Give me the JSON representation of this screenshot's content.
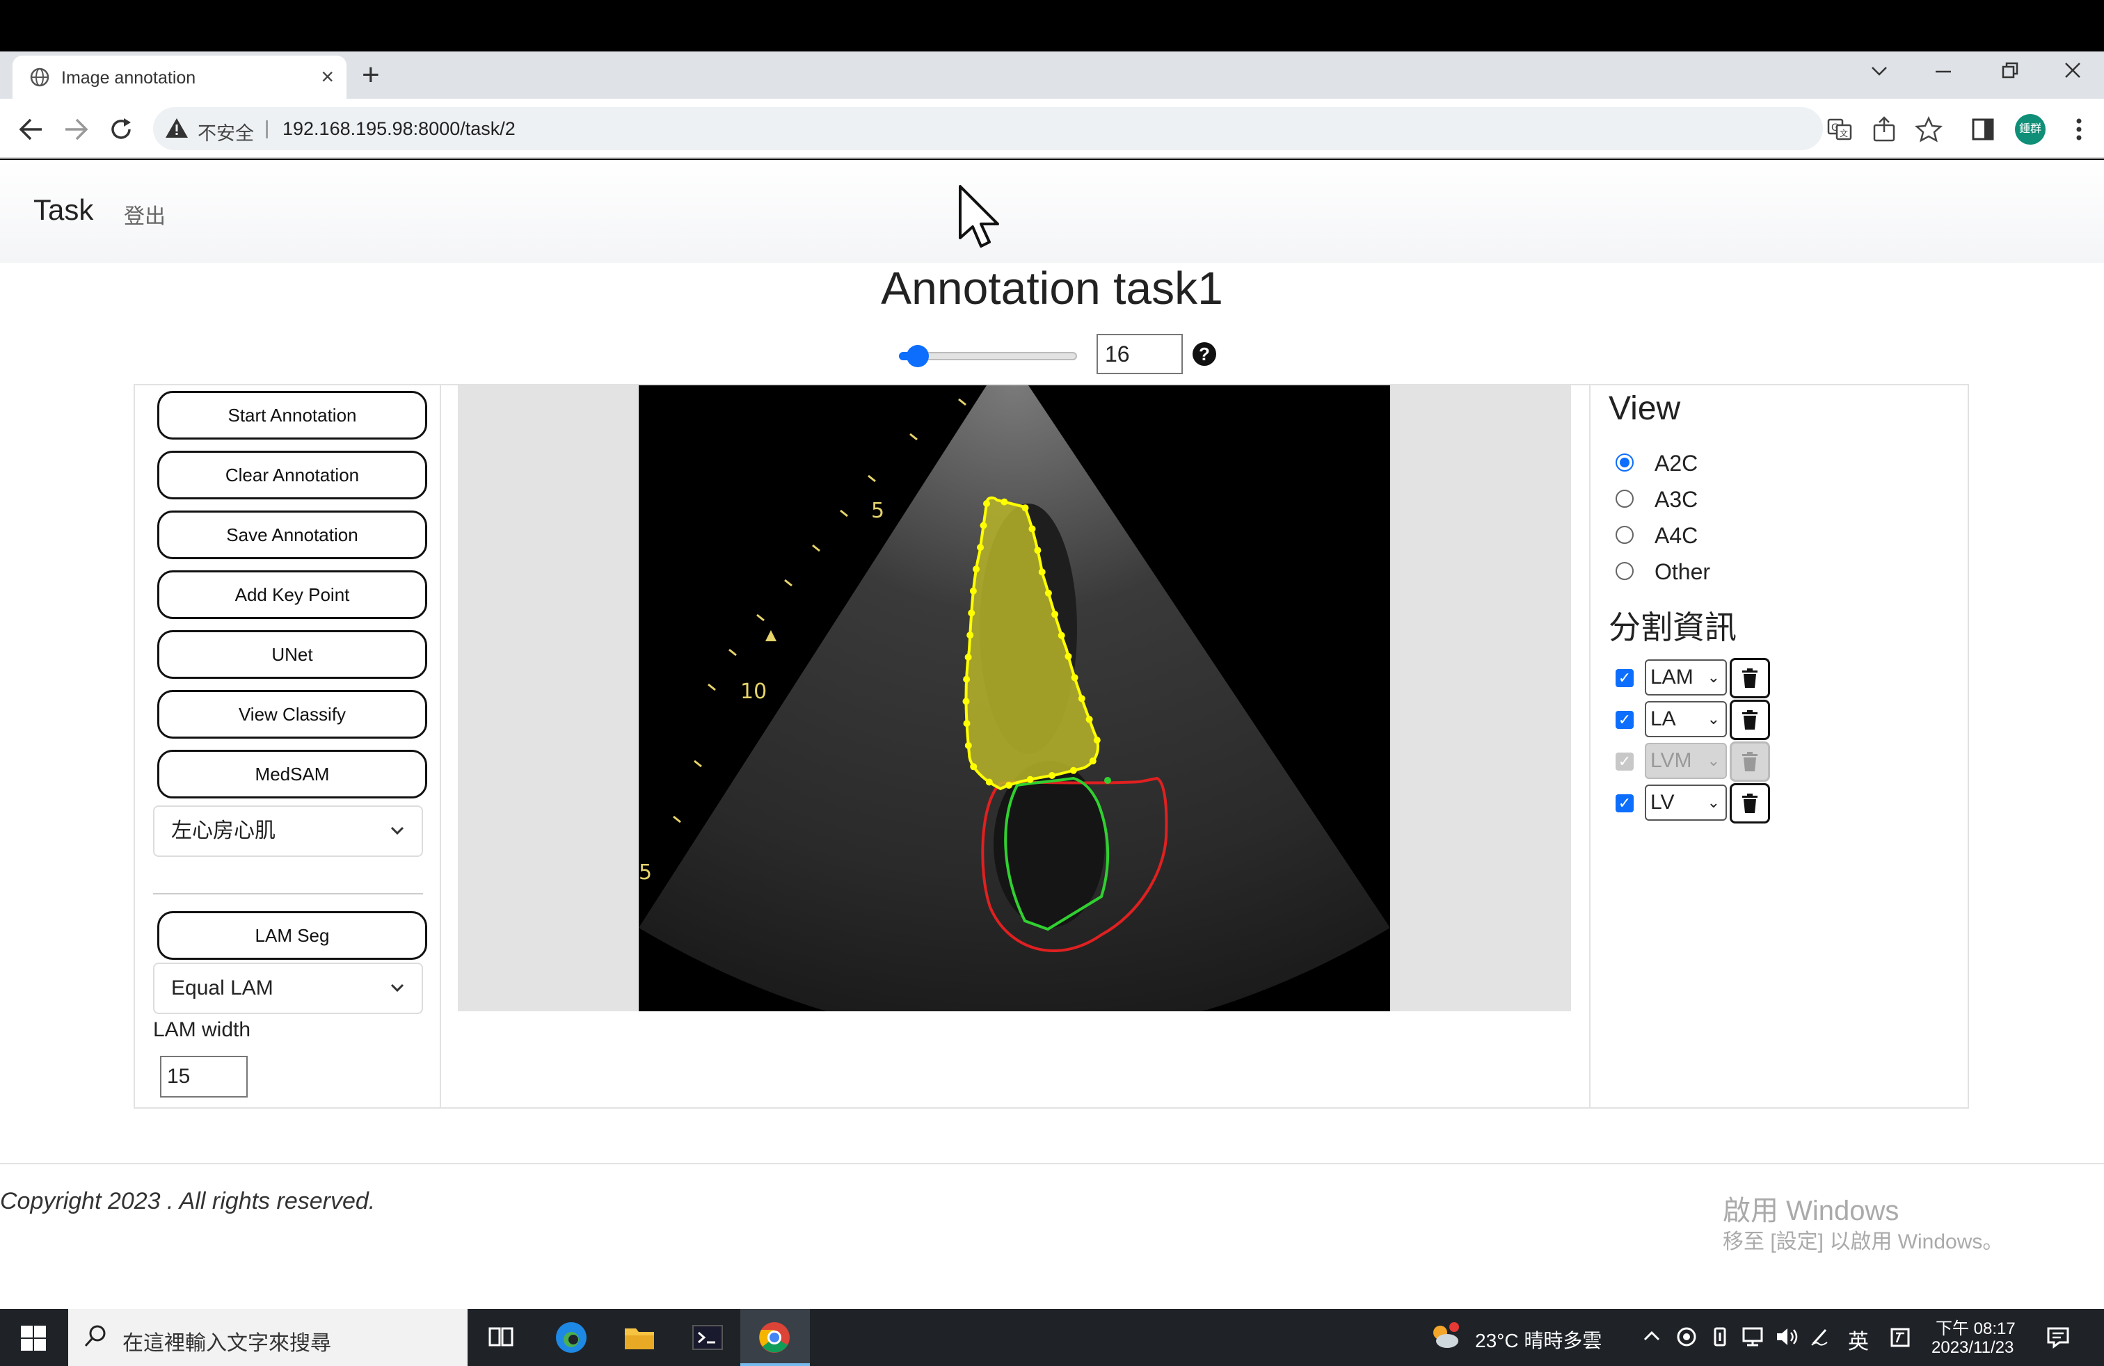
{
  "browser": {
    "tab_title": "Image annotation",
    "tab_close": "×",
    "new_tab": "+",
    "url_insecure": "不安全",
    "url_separator": "|",
    "url": "192.168.195.98:8000/task/2",
    "avatar_text": "鍾群"
  },
  "nav": {
    "brand": "Task",
    "logout": "登出"
  },
  "page": {
    "title": "Annotation task1",
    "frame_value": "16",
    "frame_fraction": 0.05,
    "help": "?"
  },
  "left_panel": {
    "buttons": [
      "Start Annotation",
      "Clear Annotation",
      "Save Annotation",
      "Add Key Point",
      "UNet",
      "View Classify",
      "MedSAM"
    ],
    "structure_select": "左心房心肌",
    "lam_seg_button": "LAM Seg",
    "lam_mode_select": "Equal LAM",
    "lam_width_label": "LAM width",
    "lam_width_value": "15"
  },
  "echo_image": {
    "depth_labels": [
      "5",
      "10",
      "5"
    ]
  },
  "right_panel": {
    "view_heading": "View",
    "views": [
      {
        "label": "A2C",
        "checked": true
      },
      {
        "label": "A3C",
        "checked": false
      },
      {
        "label": "A4C",
        "checked": false
      },
      {
        "label": "Other",
        "checked": false
      }
    ],
    "seg_heading": "分割資訊",
    "segments": [
      {
        "label": "LAM",
        "disabled": false
      },
      {
        "label": "LA",
        "disabled": false
      },
      {
        "label": "LVM",
        "disabled": true
      },
      {
        "label": "LV",
        "disabled": false
      }
    ]
  },
  "footer": {
    "copyright": "Copyright 2023 . All rights reserved.",
    "watermark_title": "啟用 Windows",
    "watermark_sub": "移至 [設定] 以啟用 Windows。"
  },
  "taskbar": {
    "search_placeholder": "在這裡輸入文字來搜尋",
    "weather": "23°C  晴時多雲",
    "ime": "英",
    "time": "下午 08:17",
    "date": "2023/11/23"
  },
  "colors": {
    "accent": "#0d6efd",
    "lam_fill": "#b8b52a",
    "lam_outline": "#ffff00",
    "la_contour": "#e02020",
    "lv_contour": "#30d030"
  }
}
